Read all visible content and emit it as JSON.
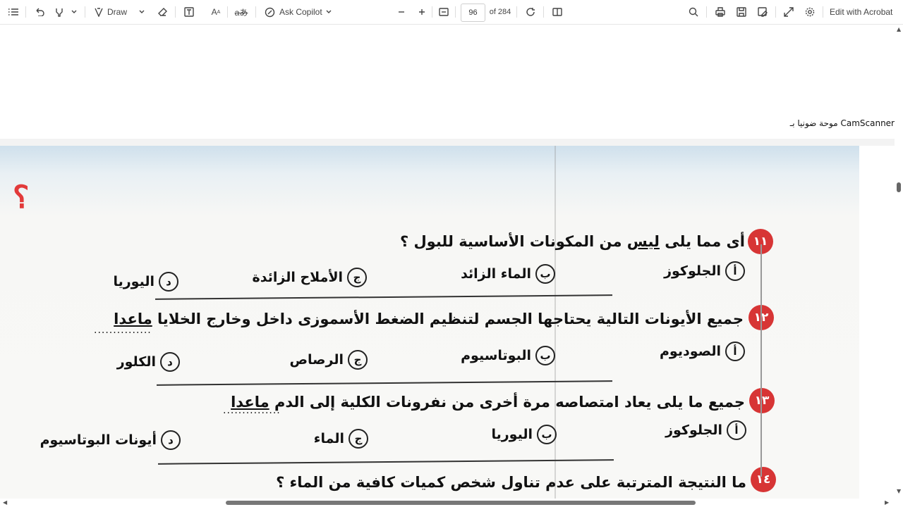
{
  "toolbar": {
    "draw_label": "Draw",
    "ask_copilot_label": "Ask Copilot",
    "page_number": "96",
    "page_total": "of 284",
    "edit_label": "Edit with Acrobat"
  },
  "page": {
    "camscanner_text": "موحة ضونيا بـ CamScanner"
  },
  "questions": [
    {
      "number": "١١",
      "text_before": "أى مما يلى ",
      "text_underlined": "ليس",
      "text_after": " من المكونات الأساسية للبول ؟",
      "options": [
        {
          "letter": "أ",
          "text": "الجلوكوز"
        },
        {
          "letter": "ب",
          "text": "الماء الزائد"
        },
        {
          "letter": "ج",
          "text": "الأملاح الزائدة"
        },
        {
          "letter": "د",
          "text": "اليوريا"
        }
      ]
    },
    {
      "number": "١٢",
      "text_before": "جميع الأيونات التالية يحتاجها الجسم لتنظيم الضغط الأسموزى داخل وخارج الخلايا ",
      "text_underlined": "ماعدا",
      "text_after": "",
      "dots": "...............",
      "options": [
        {
          "letter": "أ",
          "text": "الصوديوم"
        },
        {
          "letter": "ب",
          "text": "البوتاسيوم"
        },
        {
          "letter": "ج",
          "text": "الرصاص"
        },
        {
          "letter": "د",
          "text": "الكلور"
        }
      ]
    },
    {
      "number": "١٣",
      "text_before": "جميع ما يلى يعاد امتصاصه مرة أخرى من نفرونات الكلية إلى الدم ",
      "text_underlined": "ماعدا",
      "text_after": "",
      "dots": "...............",
      "options": [
        {
          "letter": "أ",
          "text": "الجلوكوز"
        },
        {
          "letter": "ب",
          "text": "اليوريا"
        },
        {
          "letter": "ج",
          "text": "الماء"
        },
        {
          "letter": "د",
          "text": "أيونات البوتاسيوم"
        }
      ]
    },
    {
      "number": "١٤",
      "text_before": "ما النتيجة المترتبة على عدم تناول شخص كميات كافية من الماء ؟",
      "text_underlined": "",
      "text_after": ""
    }
  ],
  "decor": {
    "question_mark": "؟"
  }
}
